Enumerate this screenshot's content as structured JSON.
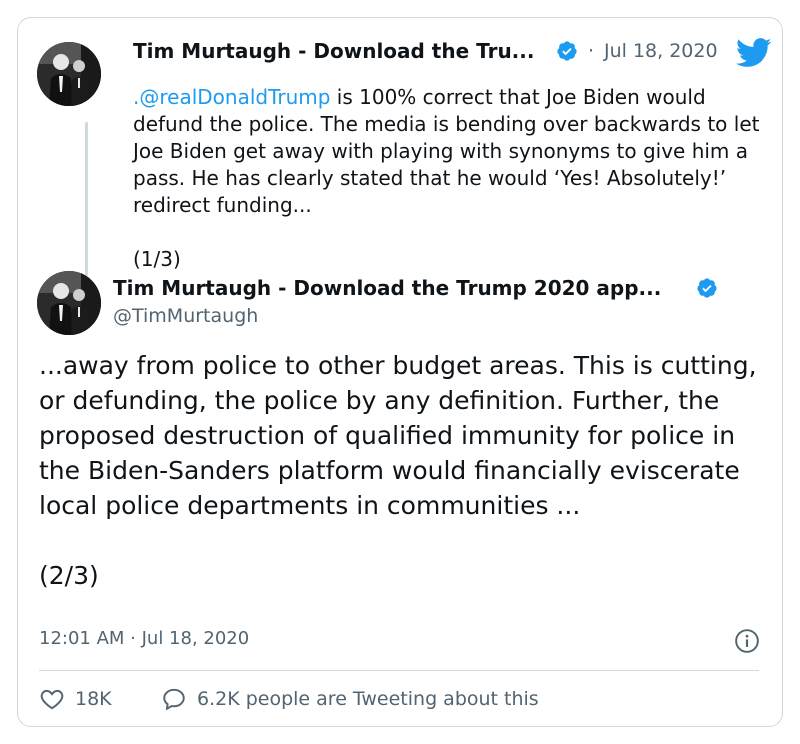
{
  "quoted_tweet": {
    "author_name": "Tim Murtaugh - Download the Tru...",
    "separator": "·",
    "date": "Jul 18, 2020",
    "mention": ".@realDonaldTrump",
    "text": " is 100% correct that Joe Biden would defund the police. The media is bending over backwards to let Joe Biden get away with playing with synonyms to give him a pass. He has clearly stated that he would ‘Yes! Absolutely!’ redirect funding...",
    "counter": "(1/3)"
  },
  "main_tweet": {
    "author_name": "Tim Murtaugh - Download the Trump 2020 app...",
    "handle": "@TimMurtaugh",
    "text": "...away from police to other budget areas. This is cutting, or defunding, the police by any definition. Further, the proposed destruction of qualified immunity for police in the Biden-Sanders platform would financially eviscerate local police departments in communities ...",
    "counter": "(2/3)",
    "timestamp": "12:01 AM · Jul 18, 2020"
  },
  "actions": {
    "likes": "18K",
    "conversation": "6.2K people are Tweeting about this"
  },
  "colors": {
    "accent": "#1d9bf0",
    "text": "#0f1419",
    "muted": "#536471",
    "border": "#cfd9de"
  },
  "icons": {
    "verified": "verified-badge-icon",
    "bird": "twitter-bird-icon",
    "info": "info-icon",
    "like": "heart-icon",
    "reply": "speech-bubble-icon"
  }
}
